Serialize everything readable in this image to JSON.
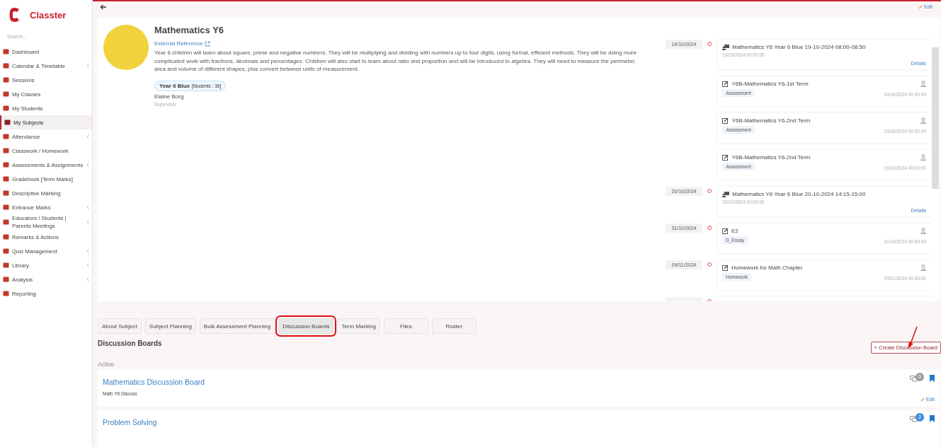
{
  "brand": {
    "name": "Classter"
  },
  "search": {
    "placeholder": "Search..."
  },
  "sidebar": {
    "items": [
      {
        "label": "Dashboard",
        "submenu": false,
        "selected": false
      },
      {
        "label": "Calendar & Timetable",
        "submenu": true,
        "selected": false
      },
      {
        "label": "Sessions",
        "submenu": false,
        "selected": false
      },
      {
        "label": "My Classes",
        "submenu": false,
        "selected": false
      },
      {
        "label": "My Students",
        "submenu": false,
        "selected": false
      },
      {
        "label": "My Subjects",
        "submenu": false,
        "selected": true
      },
      {
        "label": "Attendance",
        "submenu": true,
        "selected": false
      },
      {
        "label": "Classwork / Homework",
        "submenu": false,
        "selected": false
      },
      {
        "label": "Assessments & Assignments",
        "submenu": true,
        "selected": false
      },
      {
        "label": "Gradebook [Term Marks]",
        "submenu": false,
        "selected": false
      },
      {
        "label": "Descriptive Marking",
        "submenu": false,
        "selected": false
      },
      {
        "label": "Entrance Marks",
        "submenu": true,
        "selected": false
      },
      {
        "label": "Educators / Students | Parents Meetings",
        "submenu": true,
        "selected": false
      },
      {
        "label": "Remarks & Actions",
        "submenu": false,
        "selected": false
      },
      {
        "label": "Quiz Management",
        "submenu": true,
        "selected": false
      },
      {
        "label": "Library",
        "submenu": true,
        "selected": false
      },
      {
        "label": "Analysis",
        "submenu": true,
        "selected": false
      },
      {
        "label": "Reporting",
        "submenu": false,
        "selected": false
      }
    ]
  },
  "top_bar": {
    "edit": "Edit"
  },
  "subject": {
    "title": "Mathematics Y6",
    "external_link": "External Reference",
    "description": "Year 6 children will learn about square, prime and negative numbers. They will be multiplying and dividing with numbers up to four digits, using formal, efficient methods. They will be doing more complicated work with fractions, decimals and percentages. Children will also start to learn about ratio and proportion and will be introduced to algebra. They will need to measure the perimeter, area and volume of different shapes, plus convert between units of measurement.",
    "class_name": "Year 6 Blue",
    "class_count": "[Students : 36]",
    "teacher": "Elaine Borg",
    "teacher_role": "Supervisor"
  },
  "timeline": [
    {
      "date": "19/10/2024",
      "items": [
        {
          "kind": "session",
          "title": "Mathematics Y6 Year 6 Blue 19-10-2024 08:00-08:50",
          "datetime": "19/10/2024 00:00:00",
          "link": "Details"
        },
        {
          "kind": "assessment",
          "title": "Y6B-Mathematics Y6-1st Term",
          "tag": "Assessment",
          "datetime": "19/10/2024 00:00:00"
        },
        {
          "kind": "assessment",
          "title": "Y6B-Mathematics Y6-2nd Term",
          "tag": "Assessment",
          "datetime": "19/10/2024 00:00:00"
        },
        {
          "kind": "assessment",
          "title": "Y6B-Mathematics Y6-2nd Term",
          "tag": "Assessment",
          "datetime": "19/10/2024 00:00:00"
        }
      ]
    },
    {
      "date": "20/10/2024",
      "items": [
        {
          "kind": "session",
          "title": "Mathematics Y6 Year 6 Blue 20-10-2024 14:15-15:00",
          "datetime": "20/10/2024 00:00:00",
          "link": "Details"
        }
      ]
    },
    {
      "date": "31/10/2024",
      "items": [
        {
          "kind": "assessment",
          "title": "E2",
          "tag": "D_Essay",
          "datetime": "31/10/2024 00:00:00"
        }
      ]
    },
    {
      "date": "09/11/2024",
      "items": [
        {
          "kind": "assessment",
          "title": "Homework for Math Chapter",
          "tag": "Homework",
          "datetime": "09/11/2024 00:00:00"
        }
      ]
    }
  ],
  "tabs": [
    {
      "label": "About Subject",
      "selected": false,
      "highlighted": false
    },
    {
      "label": "Subject Planning",
      "selected": false,
      "highlighted": false
    },
    {
      "label": "Bulk Assessment Planning",
      "selected": false,
      "highlighted": false
    },
    {
      "label": "Discussion Boards",
      "selected": true,
      "highlighted": true
    },
    {
      "label": "Term Marking",
      "selected": false,
      "highlighted": false
    },
    {
      "label": "Files",
      "selected": false,
      "highlighted": false
    },
    {
      "label": "Roster",
      "selected": false,
      "highlighted": false
    }
  ],
  "section": {
    "title": "Discussion Boards",
    "create_button": "+ Create Discussion Board",
    "group_label": "Active"
  },
  "boards": [
    {
      "title": "Mathematics Discussion Board",
      "subtitle": "Math Y6 Discuss",
      "count": "0",
      "color": "#9e9e9e",
      "edit": "Edit"
    },
    {
      "title": "Problem Solving",
      "count": "2",
      "color": "#3a8fd8"
    }
  ]
}
